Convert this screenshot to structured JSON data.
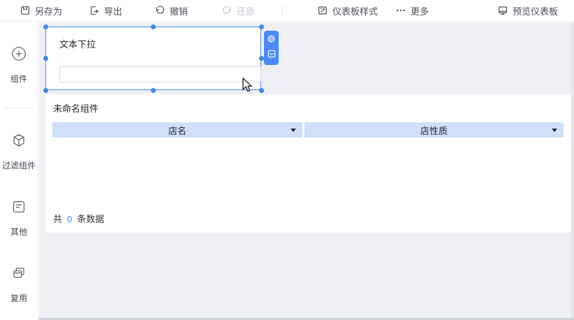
{
  "toolbar": {
    "items": [
      {
        "id": "save-as",
        "label": "另存为",
        "icon": "save-as-icon",
        "disabled": false
      },
      {
        "id": "export",
        "label": "导出",
        "icon": "export-icon",
        "disabled": false
      },
      {
        "id": "undo",
        "label": "撤销",
        "icon": "undo-icon",
        "disabled": false
      },
      {
        "id": "redo",
        "label": "还原",
        "icon": "redo-icon",
        "disabled": true
      },
      {
        "id": "dashboard-style",
        "label": "仪表板样式",
        "icon": "dashboard-style-icon",
        "disabled": false
      },
      {
        "id": "more",
        "label": "更多",
        "icon": "more-icon",
        "disabled": false
      },
      {
        "id": "preview",
        "label": "预览仪表板",
        "icon": "preview-dashboard-icon",
        "disabled": false
      }
    ]
  },
  "sidebar": {
    "items": [
      {
        "id": "components",
        "label": "组件",
        "icon": "plus-circle-icon"
      },
      {
        "id": "filter-components",
        "label": "过滤组件",
        "icon": "cube-icon"
      },
      {
        "id": "other",
        "label": "其他",
        "icon": "form-icon"
      },
      {
        "id": "reuse",
        "label": "复用",
        "icon": "stacked-windows-icon"
      }
    ]
  },
  "canvas": {
    "selected_widget": {
      "title": "文本下拉",
      "input_value": "",
      "actions": [
        {
          "id": "settings",
          "icon": "gear-icon"
        },
        {
          "id": "dropdown-style",
          "icon": "chevron-square-icon"
        }
      ]
    },
    "table_widget": {
      "title": "未命名组件",
      "columns": [
        {
          "label": "店名"
        },
        {
          "label": "店性质"
        }
      ],
      "rows": [],
      "footer": {
        "prefix": "共",
        "count": "0",
        "suffix": "条数据"
      }
    }
  },
  "colors": {
    "accent": "#4a8bf4",
    "selection_border": "#4a8bf4",
    "table_header_bg": "#cfe0f8",
    "canvas_bg": "#eef0f4",
    "disabled_text": "#c3c7ce"
  }
}
